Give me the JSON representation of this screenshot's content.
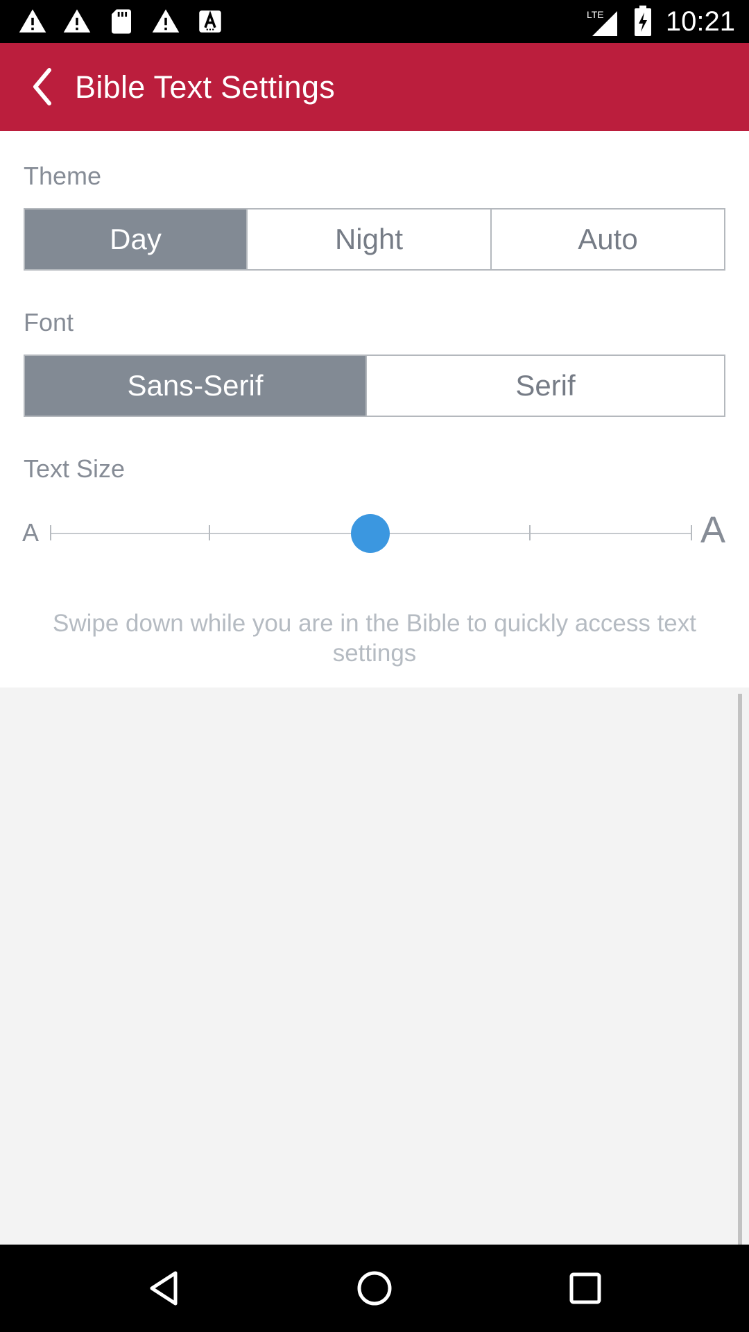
{
  "status_bar": {
    "left_icons": [
      "warning-icon",
      "warning-icon",
      "sd-card-icon",
      "warning-icon",
      "font-download-icon"
    ],
    "network": "LTE",
    "time": "10:21"
  },
  "app_bar": {
    "title": "Bible Text Settings",
    "background": "#bb1e3d"
  },
  "theme": {
    "label": "Theme",
    "options": [
      "Day",
      "Night",
      "Auto"
    ],
    "selected": "Day"
  },
  "font": {
    "label": "Font",
    "options": [
      "Sans-Serif",
      "Serif"
    ],
    "selected": "Sans-Serif"
  },
  "text_size": {
    "label": "Text Size",
    "small_label": "A",
    "large_label": "A",
    "steps": 5,
    "selected_step": 3,
    "thumb_color": "#3b97e0"
  },
  "hint": "Swipe down while you are in the Bible to quickly access text settings",
  "nav_bar": {
    "buttons": [
      "back-icon",
      "home-icon",
      "recents-icon"
    ]
  }
}
